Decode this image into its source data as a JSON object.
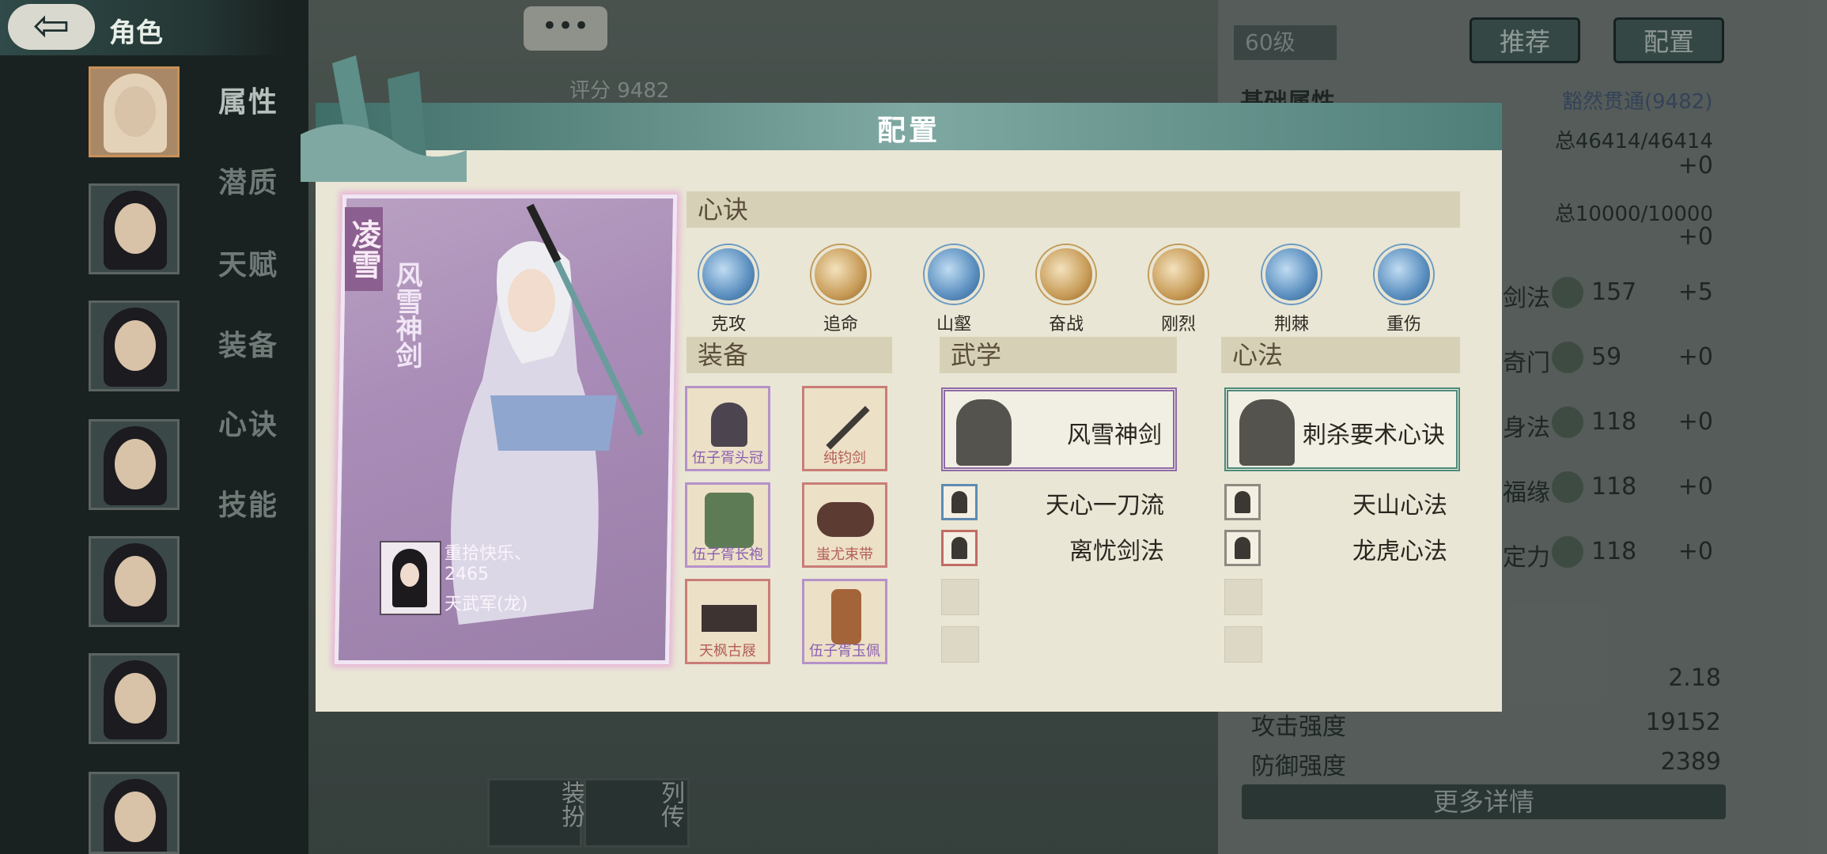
{
  "sidebar": {
    "title": "角色",
    "tabs": [
      "属性",
      "潜质",
      "天赋",
      "装备",
      "心诀",
      "技能"
    ]
  },
  "background": {
    "score_label": "评分",
    "score_value": "9482",
    "level": "60级",
    "recommend_button": "推荐",
    "config_button": "配置",
    "basic_attr": "基础属性",
    "mastery": "豁然贯通(9482)",
    "total_a": "总46414/46414",
    "plus_a": "+0",
    "total_b": "总10000/10000",
    "plus_b": "+0",
    "stats": [
      {
        "name": "剑法",
        "value": "157",
        "bonus": "+5"
      },
      {
        "name": "奇门",
        "value": "59",
        "bonus": "+0"
      },
      {
        "name": "身法",
        "value": "118",
        "bonus": "+0"
      },
      {
        "name": "福缘",
        "value": "118",
        "bonus": "+0"
      },
      {
        "name": "定力",
        "value": "118",
        "bonus": "+0"
      }
    ],
    "crit_value": "2.18",
    "attack_label": "攻击强度",
    "attack_value": "19152",
    "defense_label": "防御强度",
    "defense_value": "2389",
    "more_details": "更多详情",
    "bottom_buttons": [
      "装扮",
      "列传"
    ]
  },
  "modal": {
    "title": "配置",
    "hero": {
      "name": "凌雪",
      "weapon": "风雪神剑",
      "owner_name": "重拾快乐、",
      "owner_id": "2465",
      "owner_guild": "天武军(龙)"
    },
    "xinjue_header": "心诀",
    "skills": [
      {
        "label": "克攻",
        "style": "blue"
      },
      {
        "label": "追命",
        "style": "gold"
      },
      {
        "label": "山壑",
        "style": "blue"
      },
      {
        "label": "奋战",
        "style": "gold"
      },
      {
        "label": "刚烈",
        "style": "gold"
      },
      {
        "label": "荆棘",
        "style": "blue"
      },
      {
        "label": "重伤",
        "style": "blue"
      }
    ],
    "equip_header": "装备",
    "equipment": [
      {
        "label": "伍子胥头冠",
        "rarity": "purple"
      },
      {
        "label": "纯钧剑",
        "rarity": "red"
      },
      {
        "label": "伍子胥长袍",
        "rarity": "purple"
      },
      {
        "label": "蚩尤束带",
        "rarity": "red"
      },
      {
        "label": "天枫古屐",
        "rarity": "red"
      },
      {
        "label": "伍子胥玉佩",
        "rarity": "purple"
      }
    ],
    "wuxue_header": "武学",
    "wuxue_main": "风雪神剑",
    "wuxue_subs": [
      "天心一刀流",
      "离忧剑法"
    ],
    "xinfa_header": "心法",
    "xinfa_main": "刺杀要术心诀",
    "xinfa_subs": [
      "天山心法",
      "龙虎心法"
    ]
  }
}
